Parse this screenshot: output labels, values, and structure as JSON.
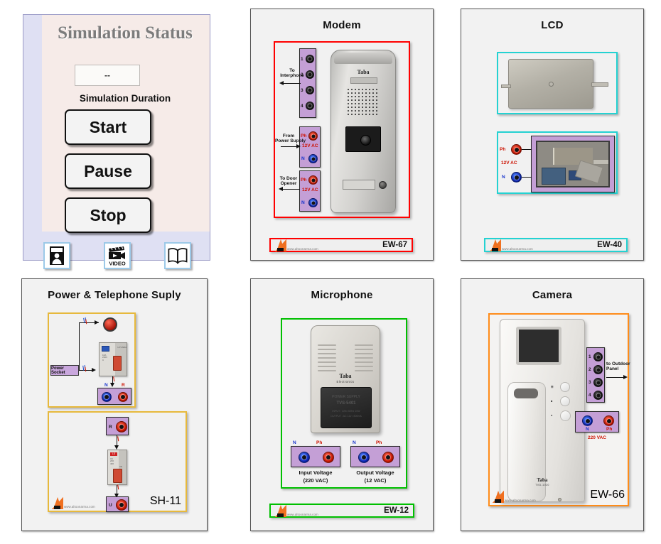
{
  "simulation": {
    "title": "Simulation Status",
    "duration_value": "--",
    "duration_label": "Simulation Duration",
    "buttons": {
      "start": "Start",
      "pause": "Pause",
      "stop": "Stop"
    },
    "tools": [
      {
        "name": "help-icon",
        "label": ""
      },
      {
        "name": "video-icon",
        "label": "VIDEO"
      },
      {
        "name": "manual-book-icon",
        "label": ""
      }
    ],
    "colors": {
      "outer_background": "#dfe0f3",
      "inner_background": "#f6ebe8",
      "title_text": "#7c7c7c",
      "tool_border": "#9cc9e8"
    }
  },
  "panels": [
    {
      "id": "modem",
      "title": "Modem",
      "accent": "#ff0000",
      "code": "EW-67",
      "logo_url": "www.altoonarma.com",
      "brand": "Taba",
      "terminals": {
        "interphone_note": "To\nInterphone",
        "interphone_pins": [
          "1",
          "2",
          "3",
          "4"
        ],
        "power_note": "From\nPower Supply",
        "power_labels": {
          "ph": "Ph",
          "n": "N",
          "voltage": "12V AC"
        },
        "door_note": "To Door\nOpener",
        "door_labels": {
          "ph": "Ph",
          "n": "N",
          "voltage": "12V AC"
        }
      }
    },
    {
      "id": "lcd",
      "title": "LCD",
      "accent": "#24d2d2",
      "code": "EW-40",
      "logo_url": "www.altoonarma.com",
      "terminals": {
        "ph": "Ph",
        "n": "N",
        "voltage": "12V AC"
      }
    },
    {
      "id": "power-supply",
      "title": "Power & Telephone Suply",
      "accent": "#e7b93c",
      "code": "SH-11",
      "logo_url": "www.altoonarma.com",
      "blocks": {
        "socket_label": "Power Socket",
        "output_n": "N",
        "output_r": "R",
        "line_in": "R",
        "line_out": "U"
      }
    },
    {
      "id": "microphone",
      "title": "Microphone",
      "accent": "#00c000",
      "code": "EW-12",
      "logo_url": "www.altoonarma.com",
      "brand": "Taba",
      "brand_sub": "Electronics",
      "device_text": {
        "line1": "POWER SUPPLY",
        "line2": "TVS-5401",
        "line3": "INPUT :  220v 50Hz 10W",
        "line4": "OUTPUT : AC 12v / 800mA"
      },
      "terminals": {
        "input": {
          "n": "N",
          "ph": "Ph",
          "caption": "Input Voltage",
          "voltage": "(220 VAC)"
        },
        "output": {
          "n": "N",
          "ph": "Ph",
          "caption": "Output Voltage",
          "voltage": "(12 VAC)"
        }
      }
    },
    {
      "id": "camera",
      "title": "Camera",
      "accent": "#ff8c19",
      "code": "EW-66",
      "logo_url": "www.altoonarma.com",
      "brand": "Taba",
      "brand_sub": "TVD-1020",
      "terminals": {
        "pins": [
          "1",
          "2",
          "3",
          "4"
        ],
        "outdoor_note": "to Outdoor\nPanel",
        "n": "N",
        "ph": "Ph",
        "voltage": "220 VAC"
      },
      "keys": [
        "☰",
        "■",
        "●"
      ]
    }
  ]
}
